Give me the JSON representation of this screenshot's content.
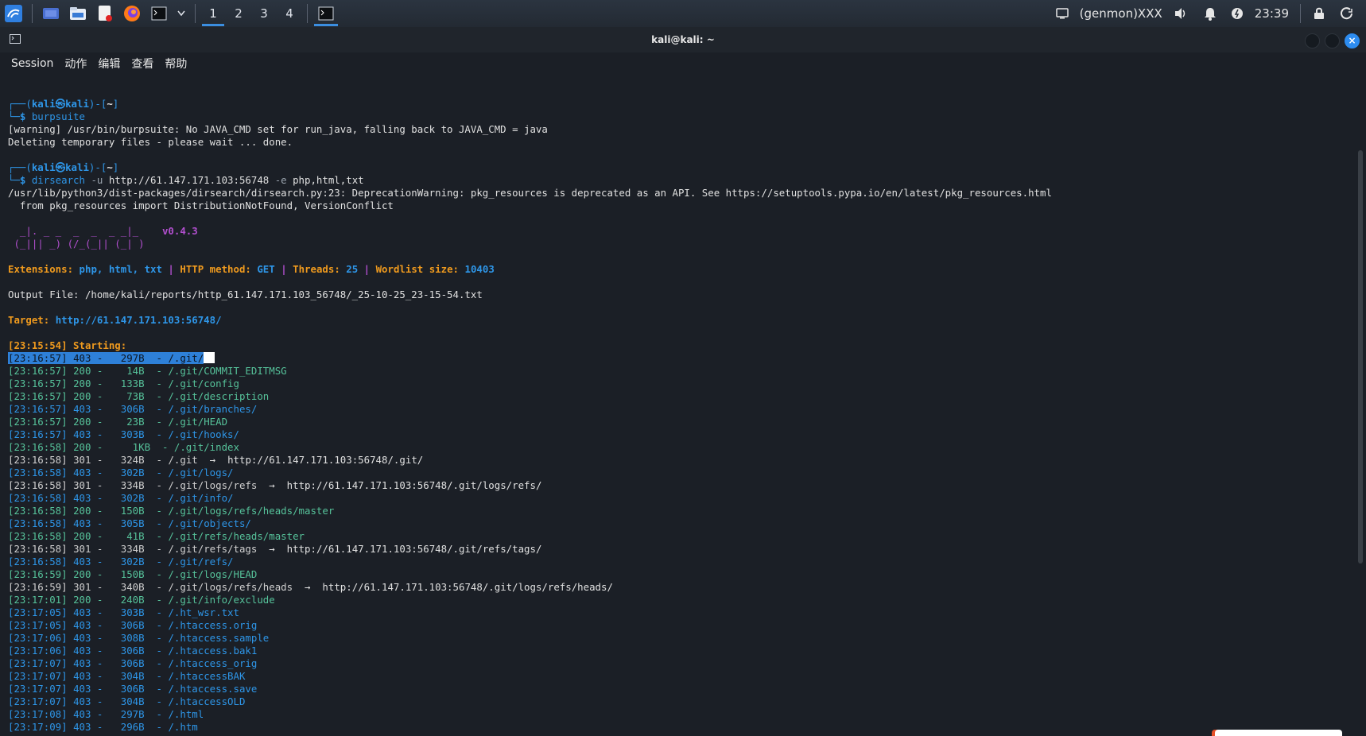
{
  "panel": {
    "workspaces": [
      "1",
      "2",
      "3",
      "4"
    ],
    "genmon": "(genmon)XXX",
    "clock": "23:39"
  },
  "window": {
    "title": "kali@kali: ~",
    "menu": [
      "Session",
      "动作",
      "编辑",
      "查看",
      "帮助"
    ]
  },
  "colors": {
    "accent": "#2e96e8",
    "orange": "#ef9a1e",
    "magenta": "#b24fcf",
    "green": "#56c29a"
  },
  "terminal": {
    "prompt_user": "kali",
    "prompt_at": "㉿",
    "prompt_host": "kali",
    "prompt_dir": "~",
    "cmd1": "burpsuite",
    "warn1": "[warning] /usr/bin/burpsuite: No JAVA_CMD set for run_java, falling back to JAVA_CMD = java",
    "warn2": "Deleting temporary files - please wait ... done.",
    "cmd2_name": "dirsearch",
    "cmd2_flag1": " -u ",
    "cmd2_url": "http://61.147.171.103:56748",
    "cmd2_flag2": " -e ",
    "cmd2_ext": "php,html,txt",
    "dep1": "/usr/lib/python3/dist-packages/dirsearch/dirsearch.py:23: DeprecationWarning: pkg_resources is deprecated as an API. See https://setuptools.pypa.io/en/latest/pkg_resources.html",
    "dep2": "  from pkg_resources import DistributionNotFound, VersionConflict",
    "logo1": "  _|. _ _  _  _  _ _|_    ",
    "logo2": " (_||| _) (/_(_|| (_| )   ",
    "version": "v0.4.3",
    "ext_label": "Extensions: ",
    "ext_value": "php, html, txt",
    "method_label": "HTTP method: ",
    "method_value": "GET",
    "threads_label": "Threads: ",
    "threads_value": "25",
    "wordlist_label": "Wordlist size: ",
    "wordlist_value": "10403",
    "output_line": "Output File: /home/kali/reports/http_61.147.171.103_56748/_25-10-25_23-15-54.txt",
    "target_label": "Target: ",
    "target_value": "http://61.147.171.103:56748/",
    "starting": "[23:15:54] Starting: ",
    "results": [
      {
        "t": "[23:16:57]",
        "c": "403",
        "s": "  297B",
        "p": "/.git/",
        "r": ""
      },
      {
        "t": "[23:16:57]",
        "c": "200",
        "s": "   14B",
        "p": "/.git/COMMIT_EDITMSG",
        "r": ""
      },
      {
        "t": "[23:16:57]",
        "c": "200",
        "s": "  133B",
        "p": "/.git/config",
        "r": ""
      },
      {
        "t": "[23:16:57]",
        "c": "200",
        "s": "   73B",
        "p": "/.git/description",
        "r": ""
      },
      {
        "t": "[23:16:57]",
        "c": "403",
        "s": "  306B",
        "p": "/.git/branches/",
        "r": ""
      },
      {
        "t": "[23:16:57]",
        "c": "200",
        "s": "   23B",
        "p": "/.git/HEAD",
        "r": ""
      },
      {
        "t": "[23:16:57]",
        "c": "403",
        "s": "  303B",
        "p": "/.git/hooks/",
        "r": ""
      },
      {
        "t": "[23:16:58]",
        "c": "200",
        "s": "    1KB",
        "p": "/.git/index",
        "r": ""
      },
      {
        "t": "[23:16:58]",
        "c": "301",
        "s": "  324B",
        "p": "/.git",
        "r": "http://61.147.171.103:56748/.git/"
      },
      {
        "t": "[23:16:58]",
        "c": "403",
        "s": "  302B",
        "p": "/.git/logs/",
        "r": ""
      },
      {
        "t": "[23:16:58]",
        "c": "301",
        "s": "  334B",
        "p": "/.git/logs/refs",
        "r": "http://61.147.171.103:56748/.git/logs/refs/"
      },
      {
        "t": "[23:16:58]",
        "c": "403",
        "s": "  302B",
        "p": "/.git/info/",
        "r": ""
      },
      {
        "t": "[23:16:58]",
        "c": "200",
        "s": "  150B",
        "p": "/.git/logs/refs/heads/master",
        "r": ""
      },
      {
        "t": "[23:16:58]",
        "c": "403",
        "s": "  305B",
        "p": "/.git/objects/",
        "r": ""
      },
      {
        "t": "[23:16:58]",
        "c": "200",
        "s": "   41B",
        "p": "/.git/refs/heads/master",
        "r": ""
      },
      {
        "t": "[23:16:58]",
        "c": "301",
        "s": "  334B",
        "p": "/.git/refs/tags",
        "r": "http://61.147.171.103:56748/.git/refs/tags/"
      },
      {
        "t": "[23:16:58]",
        "c": "403",
        "s": "  302B",
        "p": "/.git/refs/",
        "r": ""
      },
      {
        "t": "[23:16:59]",
        "c": "200",
        "s": "  150B",
        "p": "/.git/logs/HEAD",
        "r": ""
      },
      {
        "t": "[23:16:59]",
        "c": "301",
        "s": "  340B",
        "p": "/.git/logs/refs/heads",
        "r": "http://61.147.171.103:56748/.git/logs/refs/heads/"
      },
      {
        "t": "[23:17:01]",
        "c": "200",
        "s": "  240B",
        "p": "/.git/info/exclude",
        "r": ""
      },
      {
        "t": "[23:17:05]",
        "c": "403",
        "s": "  303B",
        "p": "/.ht_wsr.txt",
        "r": ""
      },
      {
        "t": "[23:17:05]",
        "c": "403",
        "s": "  306B",
        "p": "/.htaccess.orig",
        "r": ""
      },
      {
        "t": "[23:17:06]",
        "c": "403",
        "s": "  308B",
        "p": "/.htaccess.sample",
        "r": ""
      },
      {
        "t": "[23:17:06]",
        "c": "403",
        "s": "  306B",
        "p": "/.htaccess.bak1",
        "r": ""
      },
      {
        "t": "[23:17:07]",
        "c": "403",
        "s": "  306B",
        "p": "/.htaccess_orig",
        "r": ""
      },
      {
        "t": "[23:17:07]",
        "c": "403",
        "s": "  304B",
        "p": "/.htaccessBAK",
        "r": ""
      },
      {
        "t": "[23:17:07]",
        "c": "403",
        "s": "  306B",
        "p": "/.htaccess.save",
        "r": ""
      },
      {
        "t": "[23:17:07]",
        "c": "403",
        "s": "  304B",
        "p": "/.htaccessOLD",
        "r": ""
      },
      {
        "t": "[23:17:08]",
        "c": "403",
        "s": "  297B",
        "p": "/.html",
        "r": ""
      },
      {
        "t": "[23:17:09]",
        "c": "403",
        "s": "  296B",
        "p": "/.htm",
        "r": ""
      }
    ]
  }
}
